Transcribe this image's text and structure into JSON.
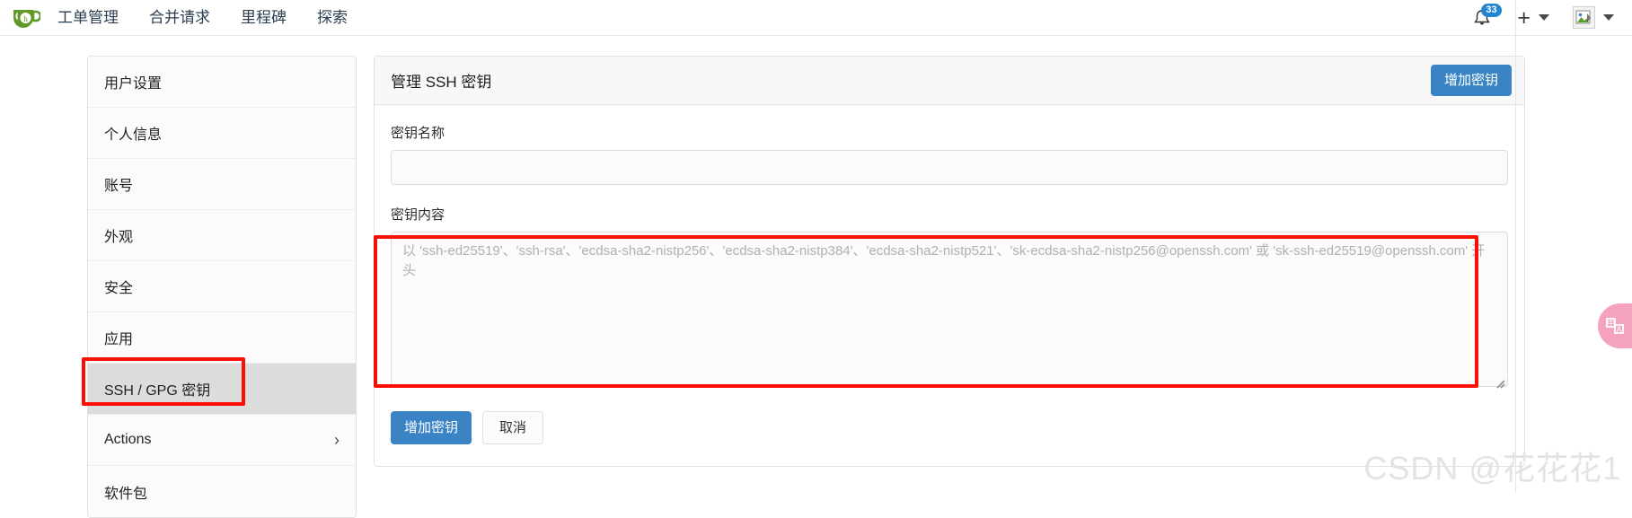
{
  "header": {
    "logo_icon": "gitea-teacup-logo",
    "nav_items": [
      {
        "label": "工单管理",
        "name": "nav-issues"
      },
      {
        "label": "合并请求",
        "name": "nav-pull-requests"
      },
      {
        "label": "里程碑",
        "name": "nav-milestones"
      },
      {
        "label": "探索",
        "name": "nav-explore"
      }
    ],
    "notifications": {
      "icon": "bell-icon",
      "count": "33"
    },
    "create_icon": "plus-icon",
    "create_caret_icon": "chevron-down-icon",
    "avatar_icon": "user-avatar-image",
    "avatar_caret_icon": "chevron-down-icon"
  },
  "sidebar": {
    "items": [
      {
        "label": "用户设置",
        "name": "sidebar-item-user-settings",
        "active": false,
        "chevron": ""
      },
      {
        "label": "个人信息",
        "name": "sidebar-item-profile",
        "active": false,
        "chevron": ""
      },
      {
        "label": "账号",
        "name": "sidebar-item-account",
        "active": false,
        "chevron": ""
      },
      {
        "label": "外观",
        "name": "sidebar-item-appearance",
        "active": false,
        "chevron": ""
      },
      {
        "label": "安全",
        "name": "sidebar-item-security",
        "active": false,
        "chevron": ""
      },
      {
        "label": "应用",
        "name": "sidebar-item-applications",
        "active": false,
        "chevron": ""
      },
      {
        "label": "SSH / GPG 密钥",
        "name": "sidebar-item-ssh-gpg-keys",
        "active": true,
        "chevron": ""
      },
      {
        "label": "Actions",
        "name": "sidebar-item-actions",
        "active": false,
        "chevron": "›"
      },
      {
        "label": "软件包",
        "name": "sidebar-item-packages",
        "active": false,
        "chevron": ""
      }
    ]
  },
  "main": {
    "card_title": "管理 SSH 密钥",
    "add_key_header_button": "增加密钥",
    "key_name_label": "密钥名称",
    "key_name_value": "",
    "key_name_placeholder": "",
    "key_content_label": "密钥内容",
    "key_content_value": "",
    "key_content_placeholder": "以 'ssh-ed25519'、'ssh-rsa'、'ecdsa-sha2-nistp256'、'ecdsa-sha2-nistp384'、'ecdsa-sha2-nistp521'、'sk-ecdsa-sha2-nistp256@openssh.com' 或 'sk-ssh-ed25519@openssh.com' 开头",
    "submit_button": "增加密钥",
    "cancel_button": "取消",
    "resize_handle_icon": "resize-grip-icon"
  },
  "widgets": {
    "translate_tab_icon": "translate-icon"
  },
  "watermark": {
    "text": "CSDN @花花花1"
  },
  "colors": {
    "primary": "#3a84c6",
    "annotation_red": "#fb0f04",
    "logo_green": "#609926",
    "badge_blue": "#2185d0",
    "translate_pink": "#f5a3bd"
  }
}
